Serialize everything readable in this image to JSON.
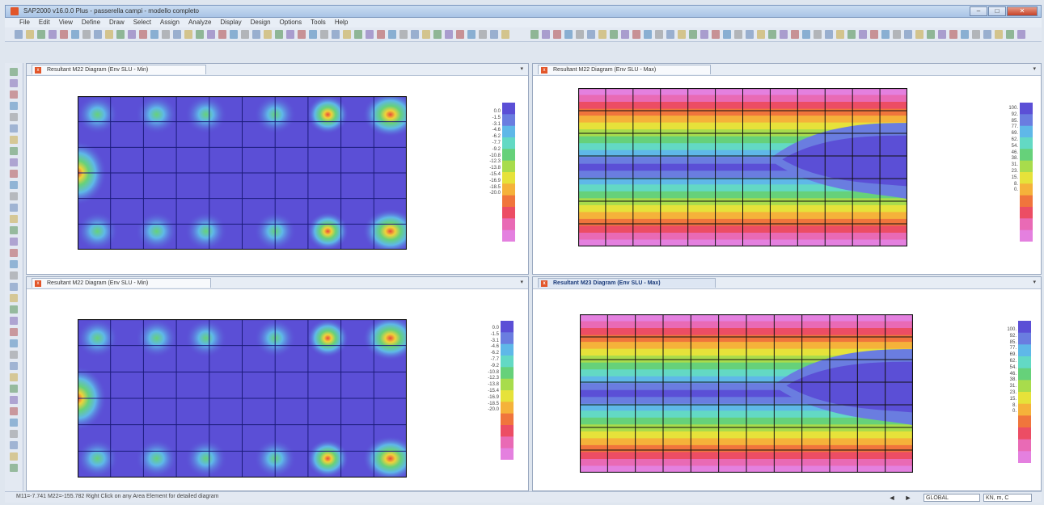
{
  "window": {
    "title": "SAP2000 v16.0.0 Plus - passerella campi - modello completo",
    "buttons": [
      "–",
      "□",
      "✕"
    ]
  },
  "menu": [
    "File",
    "Edit",
    "View",
    "Define",
    "Draw",
    "Select",
    "Assign",
    "Analyze",
    "Display",
    "Design",
    "Options",
    "Tools",
    "Help"
  ],
  "panes": [
    {
      "tab": "Resultant M22 Diagram   (Env SLU - Min)",
      "active": false,
      "menu": "▾",
      "kind": "m22",
      "legend": [
        "0.0",
        "-1.5",
        "-3.1",
        "-4.6",
        "-6.2",
        "-7.7",
        "-9.2",
        "-10.8",
        "-12.3",
        "-13.8",
        "-15.4",
        "-16.9",
        "-18.5",
        "-20.0"
      ]
    },
    {
      "tab": "Resultant M22 Diagram   (Env SLU - Max)",
      "active": false,
      "menu": "▾",
      "kind": "m23",
      "legend": [
        "100.",
        "92.",
        "85.",
        "77.",
        "69.",
        "62.",
        "54.",
        "46.",
        "38.",
        "31.",
        "23.",
        "15.",
        "8.",
        "0."
      ]
    },
    {
      "tab": "Resultant M22 Diagram   (Env SLU - Min)",
      "active": false,
      "menu": "▾",
      "kind": "m22",
      "legend": [
        "0.0",
        "-1.5",
        "-3.1",
        "-4.6",
        "-6.2",
        "-7.7",
        "-9.2",
        "-10.8",
        "-12.3",
        "-13.8",
        "-15.4",
        "-16.9",
        "-18.5",
        "-20.0"
      ]
    },
    {
      "tab": "Resultant M23 Diagram   (Env SLU - Max)",
      "active": true,
      "menu": "▾",
      "kind": "m23",
      "legend": [
        "100.",
        "92.",
        "85.",
        "77.",
        "69.",
        "62.",
        "54.",
        "46.",
        "38.",
        "31.",
        "23.",
        "15.",
        "8.",
        "0."
      ]
    }
  ],
  "status": {
    "text": "M11=-7.741  M22=-155.782  Right Click on any Area Element for detailed diagram",
    "coord_system": "GLOBAL",
    "units": "KN, m, C",
    "prev": "◄",
    "next": "►"
  },
  "colors": {
    "scale": [
      "#5b4fd6",
      "#6a7de0",
      "#5fb8e8",
      "#63d9c4",
      "#66d17a",
      "#a8dc4c",
      "#e6e23a",
      "#f5b23a",
      "#f0753c",
      "#ec4d64",
      "#e96ab5",
      "#e480df"
    ],
    "grid": "#1b1b7a",
    "accent": "#e2562a"
  }
}
